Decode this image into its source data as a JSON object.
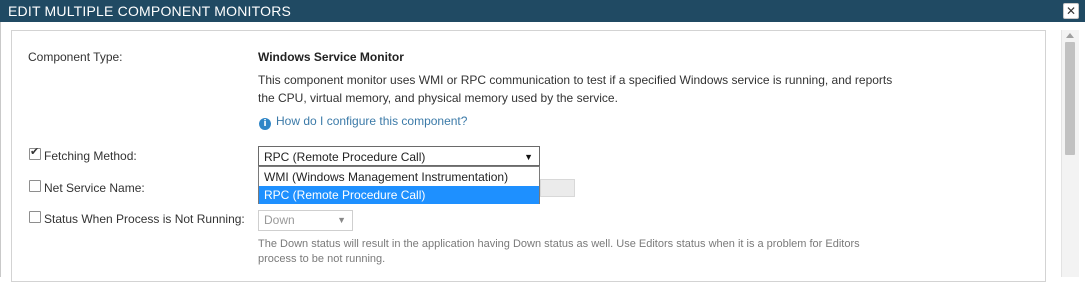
{
  "dialog": {
    "title": "EDIT MULTIPLE COMPONENT MONITORS",
    "close_glyph": "✕",
    "title_bar_color": "#204a63"
  },
  "component": {
    "type_label": "Component Type:",
    "name": "Windows Service Monitor",
    "description": "This component monitor uses WMI or RPC communication to test if a specified Windows service is running, and reports the CPU, virtual memory, and physical memory used by the service.",
    "help_link": "How do I configure this component?"
  },
  "fields": {
    "fetching_method": {
      "label": "Fetching Method:",
      "checked": true,
      "selected": "RPC (Remote Procedure Call)",
      "options": [
        "WMI (Windows Management Instrumentation)",
        "RPC (Remote Procedure Call)"
      ]
    },
    "net_service_name": {
      "label": "Net Service Name:",
      "checked": false,
      "value": ""
    },
    "status_not_running": {
      "label": "Status When Process is Not Running:",
      "checked": false,
      "selected": "Down",
      "note": "The Down status will result in the application having Down status as well. Use Editors status when it is a problem for Editors process to be not running."
    }
  },
  "colors": {
    "highlight": "#1e90ff",
    "link": "#3b7aa8"
  }
}
